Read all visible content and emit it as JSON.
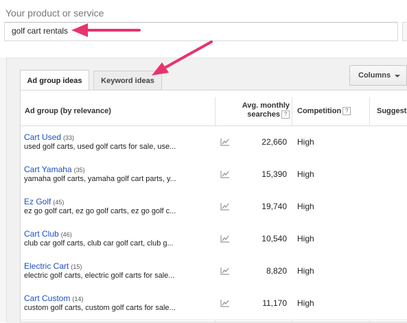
{
  "product": {
    "label": "Your product or service",
    "value": "golf cart rentals"
  },
  "tabs": [
    {
      "label": "Ad group ideas",
      "active": true
    },
    {
      "label": "Keyword ideas",
      "active": false
    }
  ],
  "columns_button": {
    "label": "Columns"
  },
  "table": {
    "headers": {
      "ad_group": "Ad group (by relevance)",
      "avg_monthly_1": "Avg. monthly",
      "avg_monthly_2": "searches",
      "competition": "Competition",
      "suggested": "Suggest",
      "help": "?"
    },
    "rows": [
      {
        "title": "Cart Used",
        "count": "(33)",
        "keywords": "used golf carts, used golf carts for sale, use...",
        "searches": "22,660",
        "competition": "High"
      },
      {
        "title": "Cart Yamaha",
        "count": "(35)",
        "keywords": "yamaha golf carts, yamaha golf cart parts, y...",
        "searches": "15,390",
        "competition": "High"
      },
      {
        "title": "Ez Golf",
        "count": "(45)",
        "keywords": "ez go golf cart, ez go golf carts, ez go golf c...",
        "searches": "19,740",
        "competition": "High"
      },
      {
        "title": "Cart Club",
        "count": "(46)",
        "keywords": "club car golf carts, club car golf cart, club g...",
        "searches": "10,540",
        "competition": "High"
      },
      {
        "title": "Electric Cart",
        "count": "(15)",
        "keywords": "electric golf carts, electric golf carts for sale...",
        "searches": "8,820",
        "competition": "High"
      },
      {
        "title": "Cart Custom",
        "count": "(14)",
        "keywords": "custom golf carts, custom golf carts for sale...",
        "searches": "11,170",
        "competition": "High"
      }
    ]
  },
  "colors": {
    "link": "#1a4fc4",
    "annotation_arrow": "#e8336d"
  }
}
